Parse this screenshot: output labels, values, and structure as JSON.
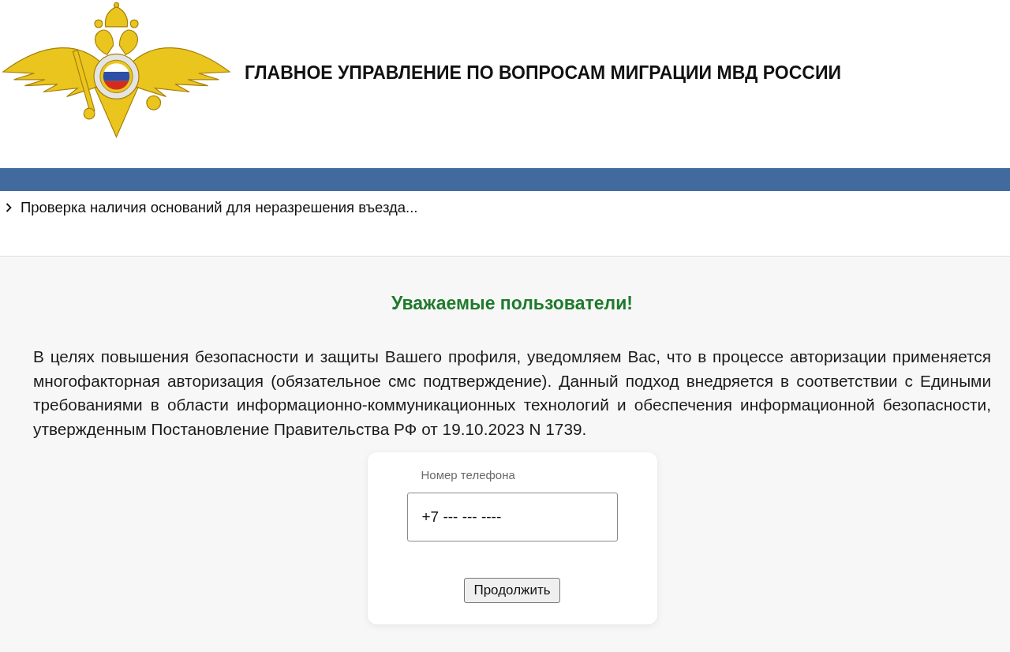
{
  "header": {
    "title": "ГЛАВНОЕ УПРАВЛЕНИЕ ПО ВОПРОСАМ МИГРАЦИИ МВД РОССИИ"
  },
  "breadcrumb": {
    "label": "Проверка наличия оснований для неразрешения въезда..."
  },
  "notice": {
    "heading": "Уважаемые пользователи!",
    "text": "В целях повышения безопасности и защиты Вашего профиля, уведомляем Вас, что в процессе авторизации применяется многофакторная авторизация (обязательное смс подтверждение). Данный подход внедряется в соответствии с Едиными требованиями в области информационно-коммуникационных технологий и обеспечения информационной безопасности, утвержденным Постановление Правительства РФ от 19.10.2023 N 1739."
  },
  "login_form": {
    "phone_field": {
      "label": "Номер телефона",
      "value": "+7 --- --- ----"
    },
    "submit_button": "Продолжить"
  }
}
